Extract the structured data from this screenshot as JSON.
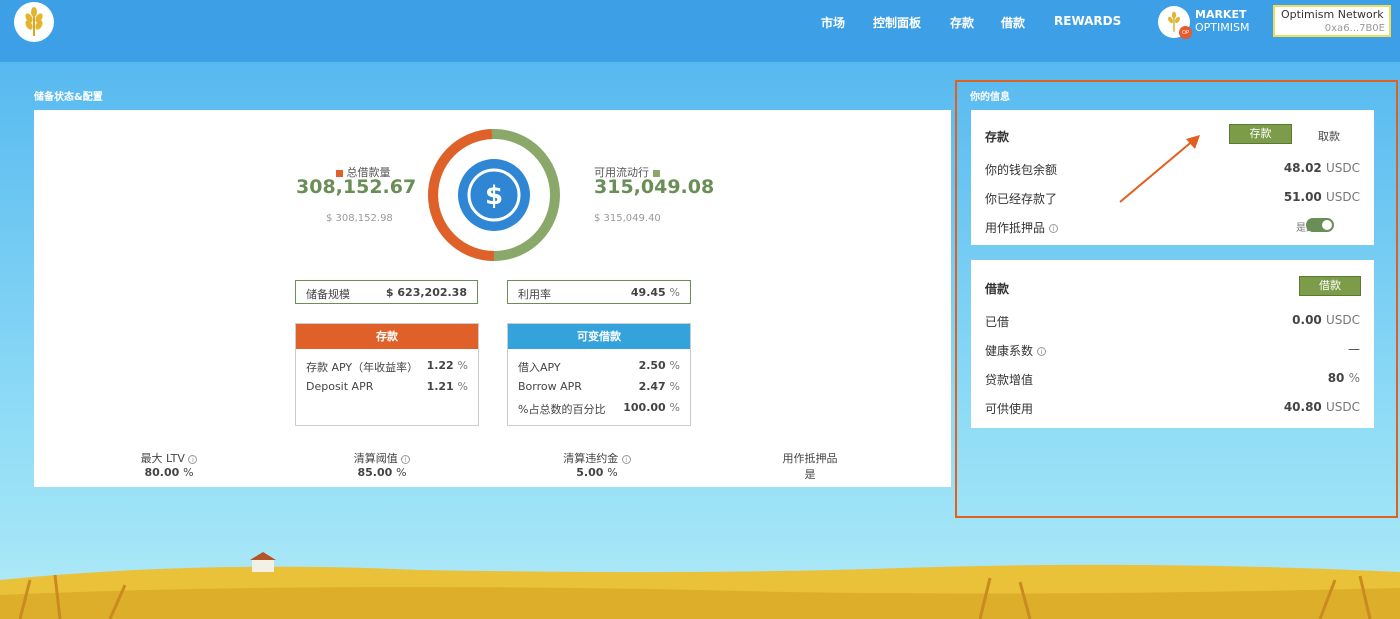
{
  "nav": {
    "items": [
      "市场",
      "控制面板",
      "存款",
      "借款",
      "REWARDS"
    ]
  },
  "market": {
    "line1": "MARKET",
    "line2": "OPTIMISM",
    "badge": "OP"
  },
  "network": {
    "name": "Optimism Network",
    "address": "0xa6...7B0E"
  },
  "reserve": {
    "section_title": "储备状态&配置",
    "total_borrowed_label": "总借款量",
    "total_borrowed": "308,152.67",
    "total_borrowed_usd": "$ 308,152.98",
    "available_label": "可用流动行",
    "available": "315,049.08",
    "available_usd": "$ 315,049.40",
    "size_label": "储备规模",
    "size_value": "$ 623,202.38",
    "util_label": "利用率",
    "util_value": "49.45",
    "util_unit": "%",
    "borrowed_fraction": 0.4945,
    "deposit": {
      "title": "存款",
      "apy_label": "存款 APY（年收益率）",
      "apy": "1.22",
      "apr_label": "Deposit APR",
      "apr": "1.21",
      "unit": "%"
    },
    "variable": {
      "title": "可变借款",
      "apy_label": "借入APY",
      "apy": "2.50",
      "apr_label": "Borrow APR",
      "apr": "2.47",
      "share_label": "%占总数的百分比",
      "share": "100.00",
      "unit": "%"
    },
    "stats": [
      {
        "label": "最大 LTV",
        "value": "80.00",
        "unit": "%"
      },
      {
        "label": "清算阈值",
        "value": "85.00",
        "unit": "%"
      },
      {
        "label": "清算违约金",
        "value": "5.00",
        "unit": "%"
      },
      {
        "label": "用作抵押品",
        "value": "是",
        "unit": ""
      }
    ]
  },
  "user": {
    "section_title": "你的信息",
    "deposit": {
      "title": "存款",
      "deposit_btn": "存款",
      "withdraw_btn": "取款",
      "wallet_label": "你的钱包余额",
      "wallet_value": "48.02",
      "wallet_unit": "USDC",
      "deposited_label": "你已经存款了",
      "deposited_value": "51.00",
      "deposited_unit": "USDC",
      "collateral_label": "用作抵押品",
      "collateral_value": "是的",
      "collateral_on": true
    },
    "borrow": {
      "title": "借款",
      "borrow_btn": "借款",
      "borrowed_label": "已借",
      "borrowed_value": "0.00",
      "borrowed_unit": "USDC",
      "health_label": "健康系数",
      "health_value": "—",
      "ltv_label": "贷款增值",
      "ltv_value": "80",
      "ltv_unit": "%",
      "avail_label": "可供使用",
      "avail_value": "40.80",
      "avail_unit": "USDC"
    }
  },
  "colors": {
    "borrowed": "#e0602a",
    "available": "#8aa86a",
    "usdc": "#2e86d4",
    "accent": "#6a8e55",
    "highlight": "#e0601f"
  }
}
